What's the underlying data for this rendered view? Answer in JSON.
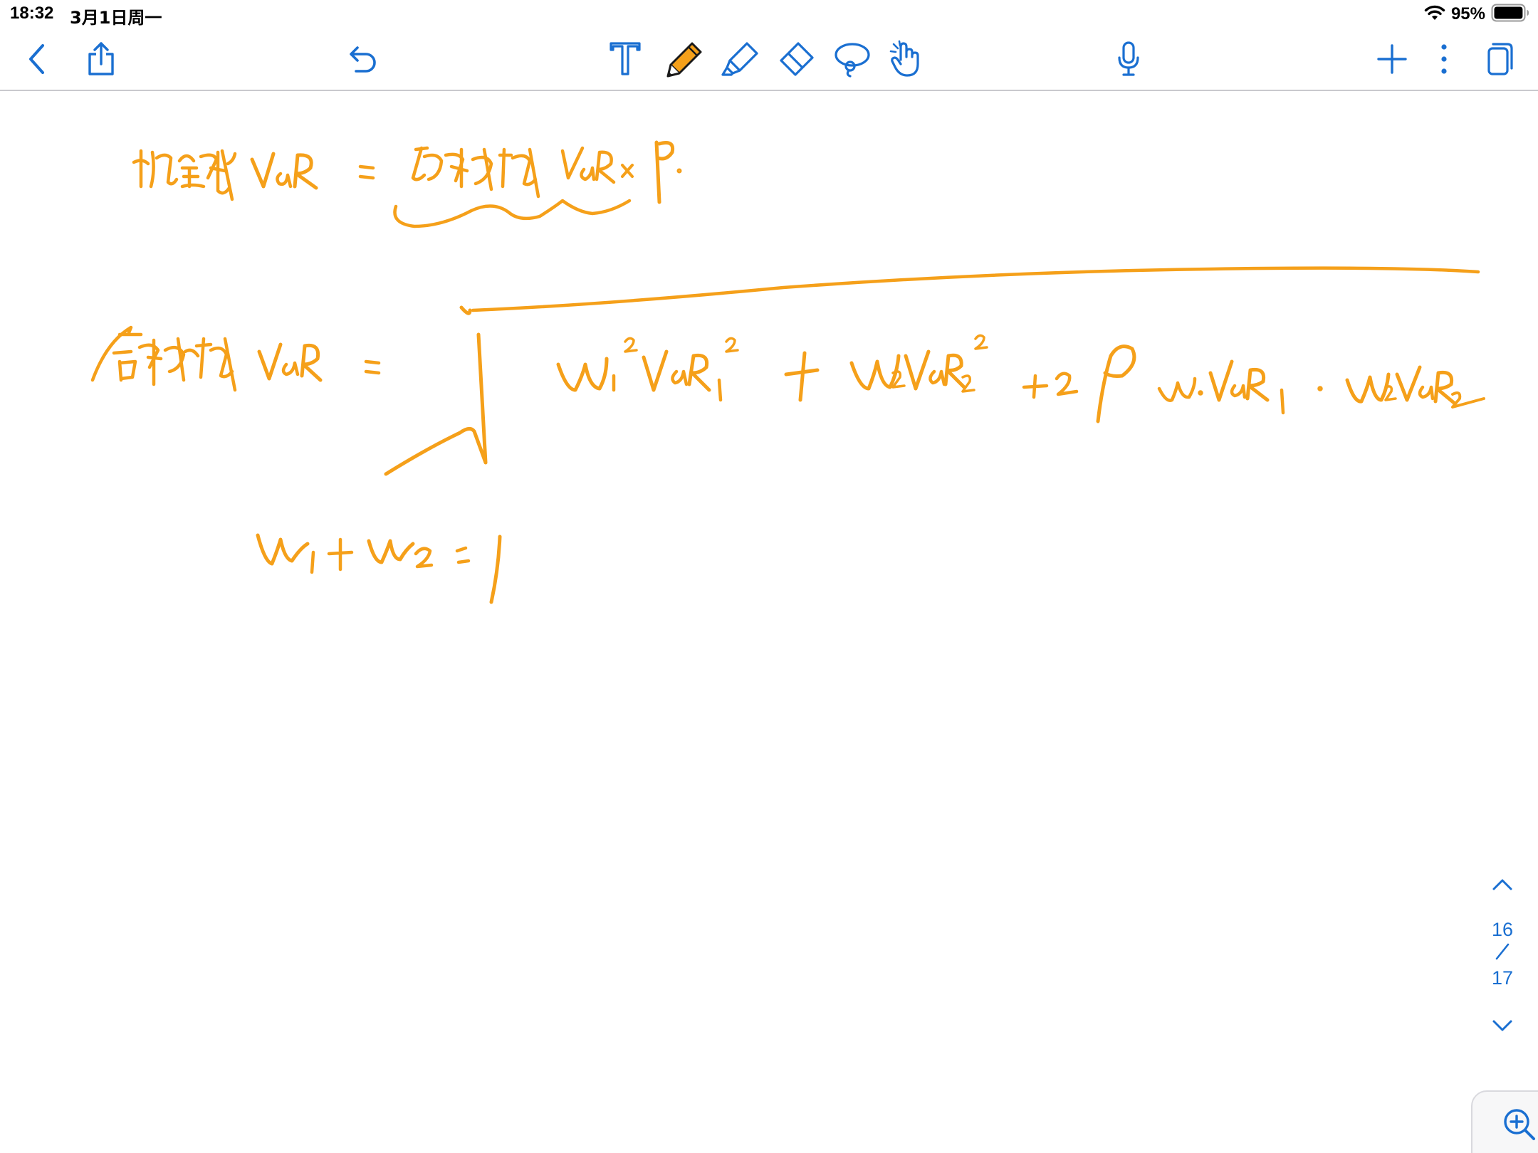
{
  "status_bar": {
    "time": "18:32",
    "date": "3月1日周一",
    "battery_percent": "95%",
    "battery_level": 0.95
  },
  "toolbar": {
    "left": [
      "back-icon",
      "share-icon",
      "undo-icon"
    ],
    "tools": [
      "text-tool-icon",
      "pen-tool-icon",
      "highlighter-tool-icon",
      "eraser-tool-icon",
      "lasso-tool-icon",
      "hand-tool-icon"
    ],
    "selected_tool": "pen-tool-icon",
    "pen_color": "#f5a01a",
    "right": [
      "microphone-icon",
      "add-icon",
      "more-icon",
      "pages-icon"
    ],
    "accent_color": "#1a6fd1"
  },
  "note": {
    "ink_color": "#f5a01a"
  },
  "page_nav": {
    "current_page": "16",
    "separator": "/",
    "total_pages": "17"
  }
}
